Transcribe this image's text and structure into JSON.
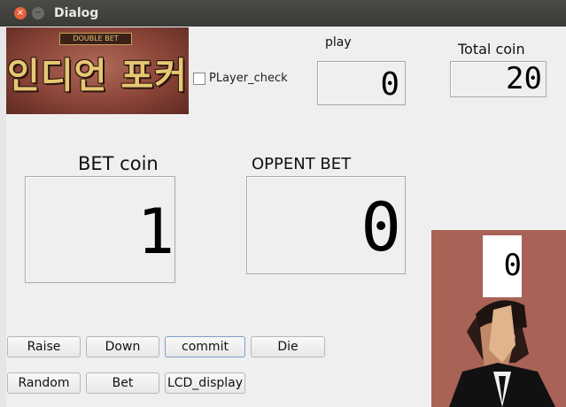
{
  "window": {
    "title": "Dialog",
    "close_glyph": "×",
    "minimize_glyph": "−"
  },
  "logo": {
    "subtitle": "DOUBLE BET",
    "text": "인디언 포커"
  },
  "player_check": {
    "label": "PLayer_check",
    "checked": false
  },
  "play": {
    "label": "play",
    "value": "0"
  },
  "total_coin": {
    "label": "Total coin",
    "value": "20"
  },
  "bet_coin": {
    "label": "BET coin",
    "value": "1"
  },
  "opponent_bet": {
    "label": "OPPENT BET",
    "value": "0"
  },
  "opponent_card": {
    "value": "0"
  },
  "buttons": {
    "raise": "Raise",
    "down": "Down",
    "commit": "commit",
    "die": "Die",
    "random": "Random",
    "bet": "Bet",
    "lcd_display": "LCD_display"
  },
  "colors": {
    "titlebar": "#3c3b37",
    "close": "#e8603c",
    "logo_gold": "#e6c774",
    "card_bg": "#a86256"
  }
}
